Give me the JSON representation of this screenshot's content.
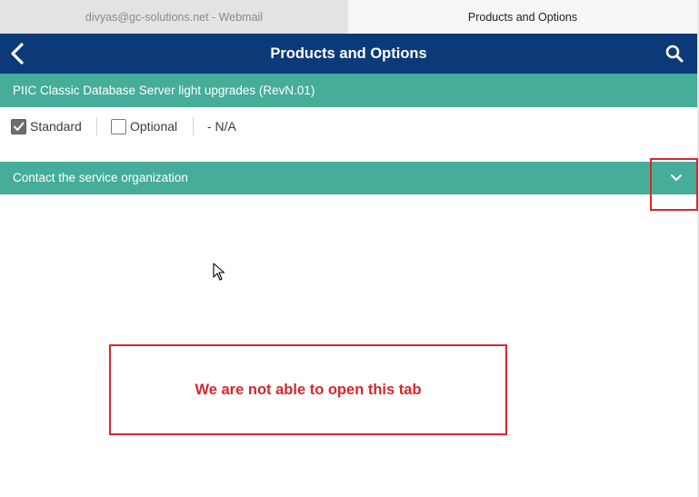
{
  "browser": {
    "tabs": [
      {
        "label": "divyas@gc-solutions.net - Webmail",
        "active": false
      },
      {
        "label": "Products and Options",
        "active": true
      }
    ]
  },
  "header": {
    "title": "Products and Options",
    "back_icon": "chevron-left-icon",
    "search_icon": "search-icon"
  },
  "product": {
    "title": "PIIC Classic Database Server light upgrades (RevN.01)"
  },
  "options": {
    "standard": {
      "label": "Standard",
      "checked": true
    },
    "optional": {
      "label": "Optional",
      "checked": false
    },
    "na_label": "- N/A"
  },
  "contact_section": {
    "label": "Contact the service organization",
    "expand_icon": "chevron-down-icon"
  },
  "annotation": {
    "message": "We are not able to open this tab"
  },
  "colors": {
    "header_bg": "#0c3a79",
    "section_bg": "#46ad98",
    "annotation": "#d8262c"
  }
}
